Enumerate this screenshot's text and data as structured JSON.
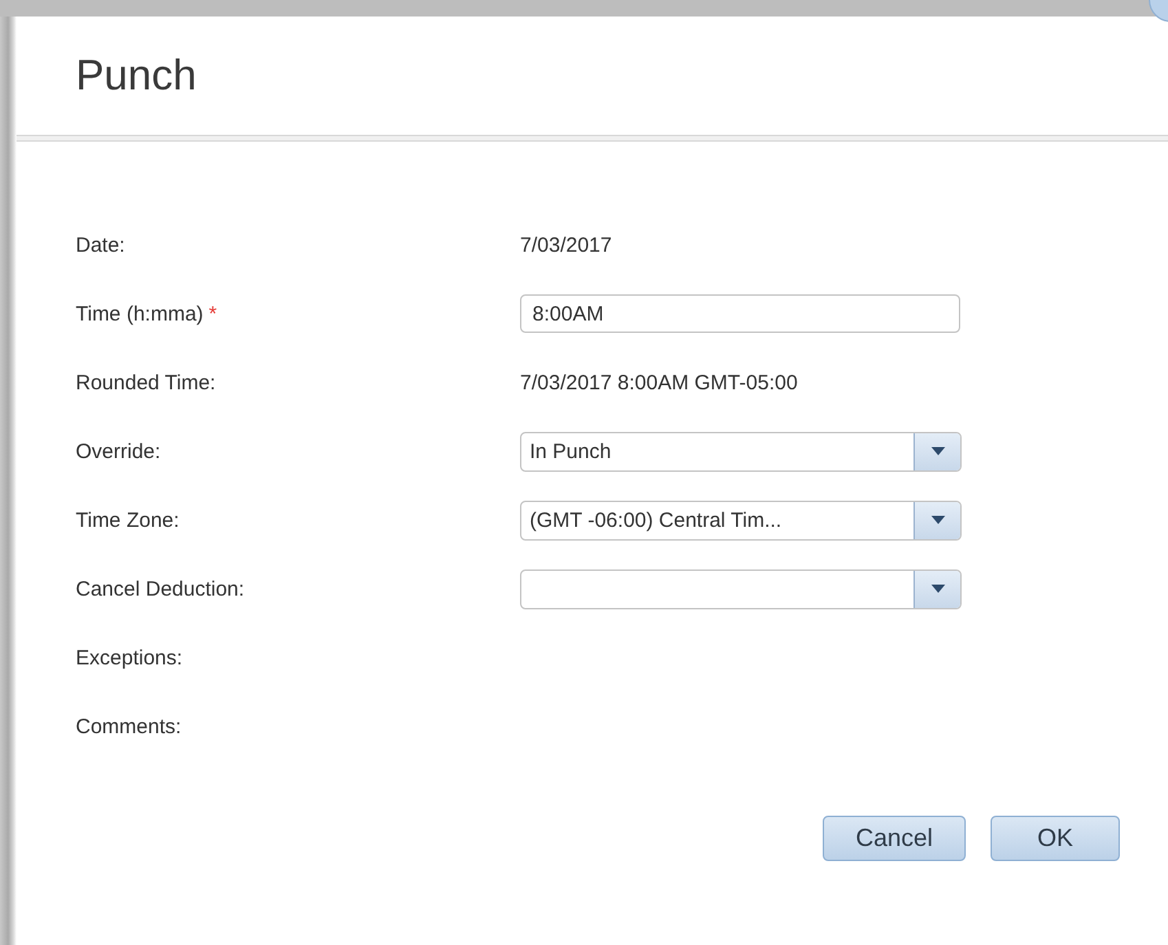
{
  "dialog": {
    "title": "Punch"
  },
  "rows": [
    {
      "label": "Date:",
      "kind": "text",
      "value": "7/03/2017"
    },
    {
      "label": "Time (h:mma)",
      "kind": "input",
      "value": "8:00AM",
      "required_mark": "*"
    },
    {
      "label": "Rounded Time:",
      "kind": "text",
      "value": "7/03/2017 8:00AM GMT-05:00"
    },
    {
      "label": "Override:",
      "kind": "select",
      "value": "In Punch"
    },
    {
      "label": "Time Zone:",
      "kind": "select",
      "value": "(GMT -06:00) Central Tim..."
    },
    {
      "label": "Cancel Deduction:",
      "kind": "select"
    },
    {
      "label": "Exceptions:",
      "kind": "text"
    },
    {
      "label": "Comments:",
      "kind": "text"
    }
  ],
  "buttons": [
    {
      "label": "Cancel"
    },
    {
      "label": "OK"
    }
  ]
}
